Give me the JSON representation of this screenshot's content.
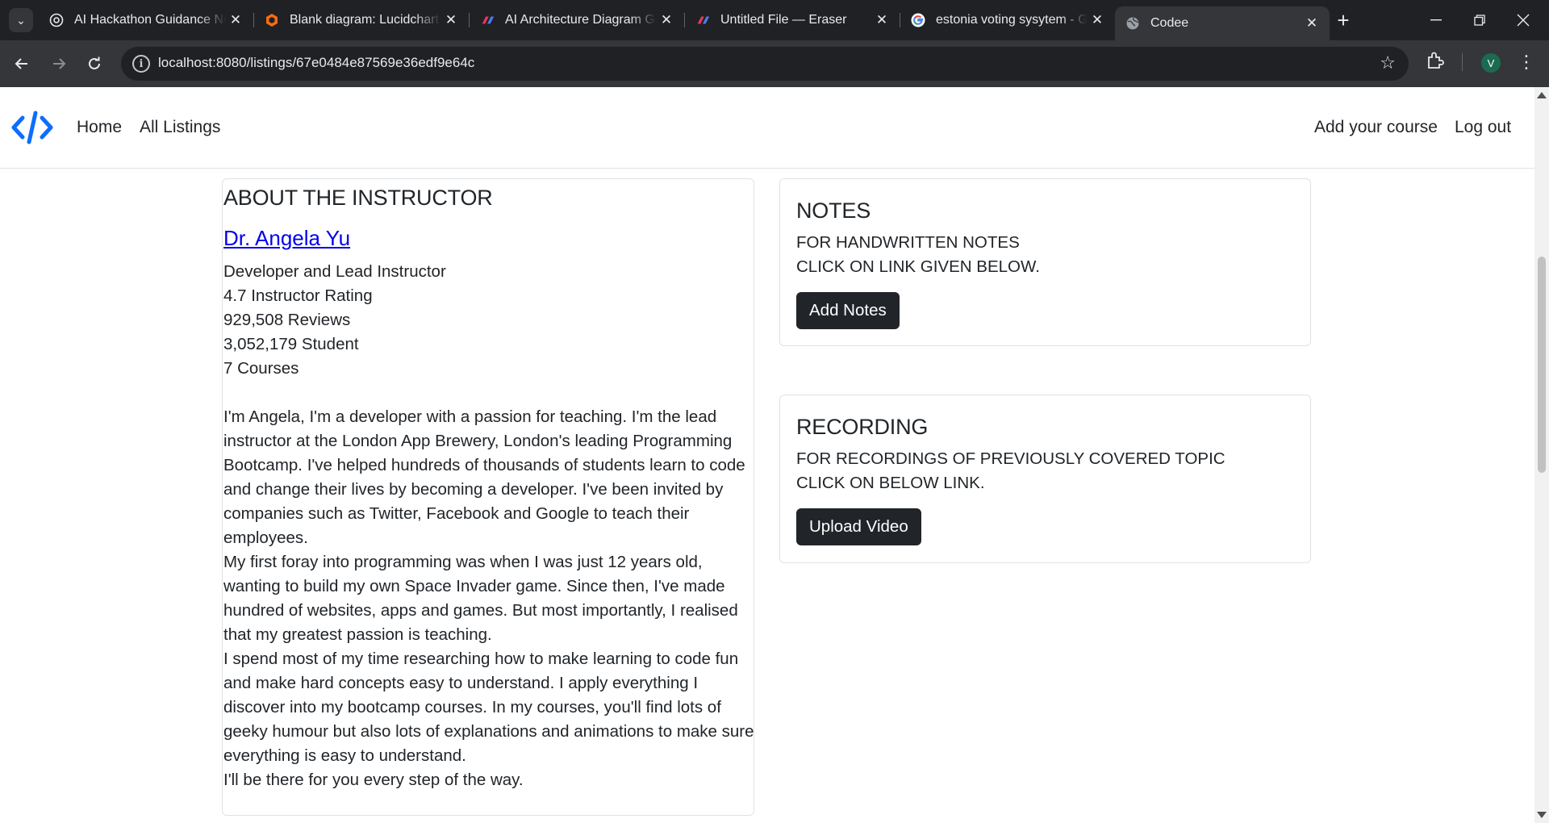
{
  "browser": {
    "tabs": [
      {
        "title": "AI Hackathon Guidance Ne",
        "icon": "openai-icon",
        "active": false
      },
      {
        "title": "Blank diagram: Lucidchart",
        "icon": "lucidchart-icon",
        "active": false
      },
      {
        "title": "AI Architecture Diagram Ge",
        "icon": "eraser-icon",
        "active": false
      },
      {
        "title": "Untitled File — Eraser",
        "icon": "eraser-icon",
        "active": false
      },
      {
        "title": "estonia voting sysytem - G",
        "icon": "google-icon",
        "active": false
      },
      {
        "title": "Codee",
        "icon": "globe-icon",
        "active": true
      }
    ],
    "url": "localhost:8080/listings/67e0484e87569e36edf9e64c",
    "profile_initial": "V"
  },
  "site": {
    "nav": {
      "home": "Home",
      "all_listings": "All Listings",
      "add_course": "Add your course",
      "logout": "Log out"
    },
    "brand_color": "#0d6efd"
  },
  "instructor": {
    "heading": "ABOUT THE INSTRUCTOR",
    "name": "Dr. Angela Yu",
    "stats": [
      "Developer and Lead Instructor",
      "4.7 Instructor Rating",
      "929,508 Reviews",
      "3,052,179 Student",
      "7 Courses"
    ],
    "bio": [
      "I'm Angela, I'm a developer with a passion for teaching. I'm the lead instructor at the London App Brewery, London's leading Programming Bootcamp. I've helped hundreds of thousands of students learn to code and change their lives by becoming a developer. I've been invited by companies such as Twitter, Facebook and Google to teach their employees.",
      "My first foray into programming was when I was just 12 years old, wanting to build my own Space Invader game. Since then, I've made hundred of websites, apps and games. But most importantly, I realised that my greatest passion is teaching.",
      "I spend most of my time researching how to make learning to code fun and make hard concepts easy to understand. I apply everything I discover into my bootcamp courses. In my courses, you'll find lots of geeky humour but also lots of explanations and animations to make sure everything is easy to understand.",
      "I'll be there for you every step of the way."
    ]
  },
  "notes": {
    "heading": "NOTES",
    "line1": "FOR HANDWRITTEN NOTES",
    "line2": "CLICK ON LINK GIVEN BELOW.",
    "button": "Add Notes"
  },
  "recording": {
    "heading": "RECORDING",
    "line1": "FOR RECORDINGS OF PREVIOUSLY COVERED TOPIC",
    "line2": "CLICK ON BELOW LINK.",
    "button": "Upload Video"
  }
}
